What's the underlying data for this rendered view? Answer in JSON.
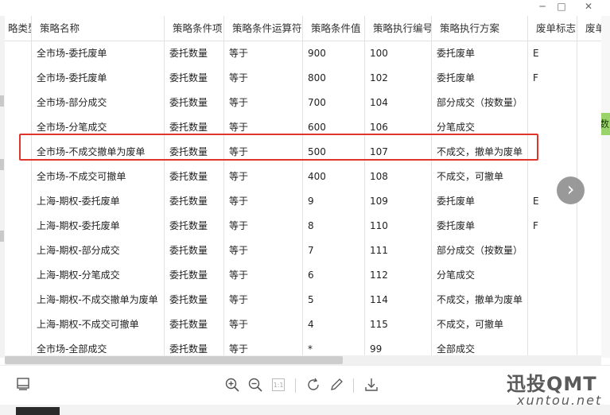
{
  "window": {
    "minimize": "─",
    "maximize": "□",
    "close": "✕"
  },
  "table": {
    "columns": [
      "略类型",
      "策略名称",
      "策略条件项",
      "策略条件运算符",
      "策略条件值",
      "策略执行编号",
      "策略执行方案",
      "废单标志",
      "废单"
    ],
    "rows": [
      [
        "",
        "全市场-委托废单",
        "委托数量",
        "等于",
        "900",
        "100",
        "委托废单",
        "E",
        ""
      ],
      [
        "",
        "全市场-委托废单",
        "委托数量",
        "等于",
        "800",
        "102",
        "委托废单",
        "F",
        ""
      ],
      [
        "",
        "全市场-部分成交",
        "委托数量",
        "等于",
        "700",
        "104",
        "部分成交（按数量）",
        "",
        ""
      ],
      [
        "",
        "全市场-分笔成交",
        "委托数量",
        "等于",
        "600",
        "106",
        "分笔成交",
        "",
        ""
      ],
      [
        "",
        "全市场-不成交撤单为废单",
        "委托数量",
        "等于",
        "500",
        "107",
        "不成交，撤单为废单",
        "",
        ""
      ],
      [
        "",
        "全市场-不成交可撤单",
        "委托数量",
        "等于",
        "400",
        "108",
        "不成交，可撤单",
        "",
        ""
      ],
      [
        "",
        "上海-期权-委托废单",
        "委托数量",
        "等于",
        "9",
        "109",
        "委托废单",
        "E",
        ""
      ],
      [
        "",
        "上海-期权-委托废单",
        "委托数量",
        "等于",
        "8",
        "110",
        "委托废单",
        "F",
        ""
      ],
      [
        "",
        "上海-期权-部分成交",
        "委托数量",
        "等于",
        "7",
        "111",
        "部分成交（按数量）",
        "",
        ""
      ],
      [
        "",
        "上海-期权-分笔成交",
        "委托数量",
        "等于",
        "6",
        "112",
        "分笔成交",
        "",
        ""
      ],
      [
        "",
        "上海-期权-不成交撤单为废单",
        "委托数量",
        "等于",
        "5",
        "114",
        "不成交，撤单为废单",
        "",
        ""
      ],
      [
        "",
        "上海-期权-不成交可撤单",
        "委托数量",
        "等于",
        "4",
        "115",
        "不成交，可撤单",
        "",
        ""
      ],
      [
        "",
        "全市场-全部成交",
        "委托数量",
        "等于",
        "*",
        "99",
        "全部成交",
        "",
        ""
      ]
    ],
    "highlighted_row": 4
  },
  "side": {
    "green_tab": "数"
  },
  "nav": {
    "next": "›"
  },
  "toolbar": {
    "icons": [
      "panel-icon",
      "zoom-in-icon",
      "zoom-out-icon",
      "actual-size-icon",
      "rotate-icon",
      "edit-icon",
      "download-icon"
    ],
    "actual_size_label": "1:1"
  },
  "watermark": {
    "line1": "迅投QMT",
    "line2": "xuntou.net"
  },
  "colors": {
    "highlight": "#e0352b",
    "green_tab": "#9ad36a"
  }
}
